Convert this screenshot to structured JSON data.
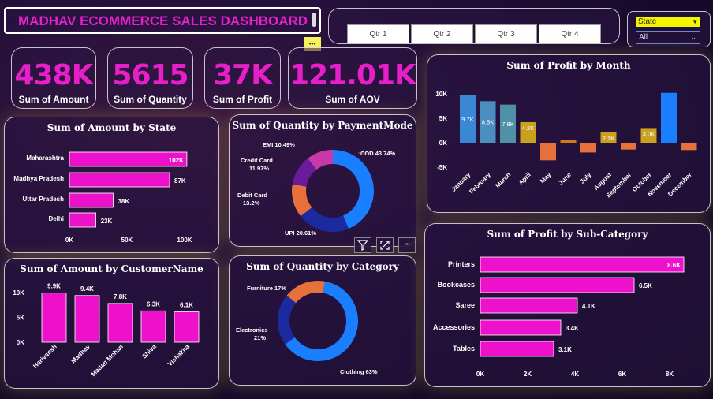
{
  "header": {
    "title": "MADHAV ECOMMERCE SALES DASHBOARD"
  },
  "quarters": [
    "Qtr 1",
    "Qtr 2",
    "Qtr 3",
    "Qtr 4"
  ],
  "filter": {
    "label": "State",
    "value": "All",
    "label_bg": "#f5f500"
  },
  "kpis": [
    {
      "value": "438K",
      "label": "Sum of Amount"
    },
    {
      "value": "5615",
      "label": "Sum of Quantity"
    },
    {
      "value": "37K",
      "label": "Sum of Profit"
    },
    {
      "value": "121.01K",
      "label": "Sum of AOV"
    }
  ],
  "colors": {
    "magenta": "#ee11cc",
    "kpi": "#e61fc9",
    "blue": "#1a7fff",
    "navy": "#1c2aa0",
    "orange": "#e8703a",
    "purple": "#6a1a9a",
    "pink": "#c63aa8",
    "gold": "#c9a020"
  },
  "menu_dots": "•••",
  "visual_icons": [
    "filter-icon",
    "focus-mode-icon",
    "more-options-icon"
  ],
  "charts": {
    "amount_by_state": {
      "title": "Sum of Amount by State",
      "chart_data": {
        "type": "bar",
        "orientation": "horizontal",
        "categories": [
          "Maharashtra",
          "Madhya Pradesh",
          "Uttar Pradesh",
          "Delhi"
        ],
        "values": [
          102,
          87,
          38,
          23
        ],
        "labels": [
          "102K",
          "87K",
          "38K",
          "23K"
        ],
        "xlim": [
          0,
          100
        ],
        "ticks": [
          "0K",
          "50K",
          "100K"
        ]
      }
    },
    "quantity_by_payment": {
      "title": "Sum of Quantity by PaymentMode",
      "chart_data": {
        "type": "pie",
        "donut": true,
        "categories": [
          "COD",
          "UPI",
          "Debit Card",
          "Credit Card",
          "EMI"
        ],
        "values": [
          43.74,
          20.61,
          13.2,
          11.97,
          10.49
        ],
        "labels": [
          "COD 43.74%",
          "UPI 20.61%",
          "Debit Card",
          "13.2%",
          "Credit Card",
          "11.97%",
          "EMI 10.49%"
        ]
      }
    },
    "profit_by_month": {
      "title": "Sum of Profit by Month",
      "chart_data": {
        "type": "bar",
        "categories": [
          "January",
          "February",
          "March",
          "April",
          "May",
          "June",
          "July",
          "August",
          "September",
          "October",
          "November",
          "December"
        ],
        "values": [
          9.7,
          8.5,
          7.8,
          4.2,
          -3.6,
          0.5,
          -2.0,
          2.1,
          -1.4,
          3.0,
          10.2,
          -1.5
        ],
        "data_labels": [
          "9.7K",
          "8.5K",
          "7.8K",
          "4.2K",
          "",
          "",
          "",
          "2.1K",
          "",
          "3.0K",
          "",
          ""
        ],
        "ylim": [
          -5,
          10
        ],
        "ticks": [
          "10K",
          "5K",
          "0K",
          "-5K"
        ]
      }
    },
    "amount_by_customer": {
      "title": "Sum of Amount by CustomerName",
      "chart_data": {
        "type": "bar",
        "categories": [
          "Harivansh",
          "Madhav",
          "Madan Mohan",
          "Shiva",
          "Vishakha"
        ],
        "values": [
          9.9,
          9.4,
          7.8,
          6.3,
          6.1
        ],
        "labels": [
          "9.9K",
          "9.4K",
          "7.8K",
          "6.3K",
          "6.1K"
        ],
        "ylim": [
          0,
          10
        ],
        "ticks": [
          "10K",
          "5K",
          "0K"
        ]
      }
    },
    "quantity_by_category": {
      "title": "Sum of Quantity by Category",
      "chart_data": {
        "type": "pie",
        "donut": true,
        "categories": [
          "Clothing",
          "Electronics",
          "Furniture"
        ],
        "values": [
          63,
          21,
          17
        ],
        "labels": [
          "Clothing 63%",
          "Electronics",
          "21%",
          "Furniture 17%"
        ]
      }
    },
    "profit_by_subcategory": {
      "title": "Sum of Profit by Sub-Category",
      "chart_data": {
        "type": "bar",
        "orientation": "horizontal",
        "categories": [
          "Printers",
          "Bookcases",
          "Saree",
          "Accessories",
          "Tables"
        ],
        "values": [
          8.6,
          6.5,
          4.1,
          3.4,
          3.1
        ],
        "labels": [
          "8.6K",
          "6.5K",
          "4.1K",
          "3.4K",
          "3.1K"
        ],
        "xlim": [
          0,
          8.6
        ],
        "ticks": [
          "0K",
          "2K",
          "4K",
          "6K",
          "8K"
        ]
      }
    }
  }
}
